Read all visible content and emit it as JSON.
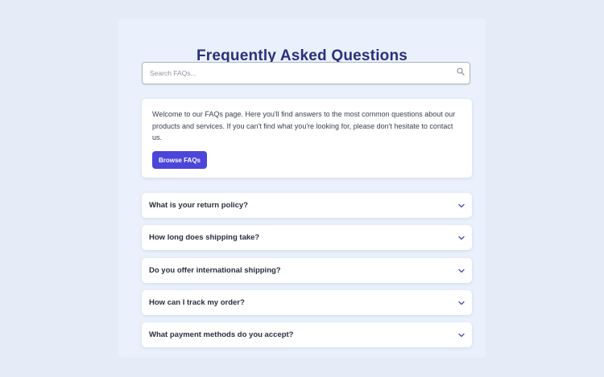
{
  "page": {
    "title": "Frequently Asked Questions"
  },
  "search": {
    "placeholder": "Search FAQs...",
    "value": "",
    "icon": "search-icon"
  },
  "intro": {
    "text": "Welcome to our FAQs page. Here you'll find answers to the most common questions about our products and services. If you can't find what you're looking for, please don't hesitate to contact us.",
    "button_label": "Browse FAQs"
  },
  "faqs": [
    {
      "question": "What is your return policy?",
      "icon": "chevron-down-icon"
    },
    {
      "question": "How long does shipping take?",
      "icon": "chevron-down-icon"
    },
    {
      "question": "Do you offer international shipping?",
      "icon": "chevron-down-icon"
    },
    {
      "question": "How can I track my order?",
      "icon": "chevron-down-icon"
    },
    {
      "question": "What payment methods do you accept?",
      "icon": "chevron-down-icon"
    }
  ],
  "colors": {
    "background": "#e5ebf7",
    "panel": "#eaf1fd",
    "title": "#2a2f7c",
    "accent": "#4b46d9",
    "chevron": "#4a4fb0"
  }
}
